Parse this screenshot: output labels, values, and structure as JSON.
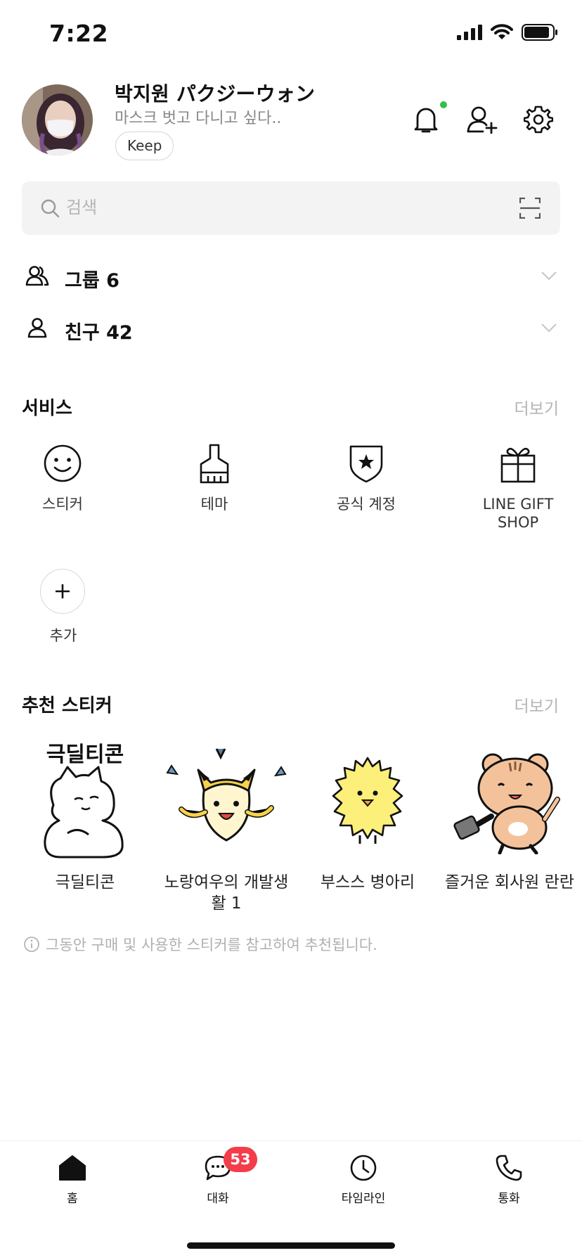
{
  "status_bar": {
    "time": "7:22"
  },
  "profile": {
    "name": "박지원 パクジーウォン",
    "status_message": "마스크 벗고 다니고 싶다..",
    "keep_label": "Keep"
  },
  "search": {
    "placeholder": "검색"
  },
  "lists": [
    {
      "label": "그룹 6",
      "icon": "group-icon"
    },
    {
      "label": "친구 42",
      "icon": "friend-icon"
    }
  ],
  "services": {
    "title": "서비스",
    "more": "더보기",
    "items": [
      {
        "label": "스티커",
        "icon": "smiley-icon"
      },
      {
        "label": "테마",
        "icon": "brush-icon"
      },
      {
        "label": "공식 계정",
        "icon": "shield-star-icon"
      },
      {
        "label": "LINE GIFT SHOP",
        "icon": "gift-icon"
      }
    ],
    "add_label": "추가"
  },
  "recommended_stickers": {
    "title": "추천 스티커",
    "more": "더보기",
    "items": [
      {
        "label": "극딜티콘",
        "art_text": "극딜티콘"
      },
      {
        "label": "노랑여우의 개발생활 1"
      },
      {
        "label": "부스스 병아리"
      },
      {
        "label": "즐거운 회사원 란란"
      }
    ],
    "notice": "그동안 구매 및 사용한 스티커를 참고하여 추천됩니다."
  },
  "tabs": [
    {
      "label": "홈",
      "icon": "home-icon",
      "active": true
    },
    {
      "label": "대화",
      "icon": "chat-icon",
      "badge": "53"
    },
    {
      "label": "타임라인",
      "icon": "clock-icon"
    },
    {
      "label": "통화",
      "icon": "phone-icon"
    }
  ],
  "colors": {
    "accent_green": "#2fbf4f",
    "badge_red": "#f33d4a",
    "muted_text": "#b5b5b5"
  }
}
